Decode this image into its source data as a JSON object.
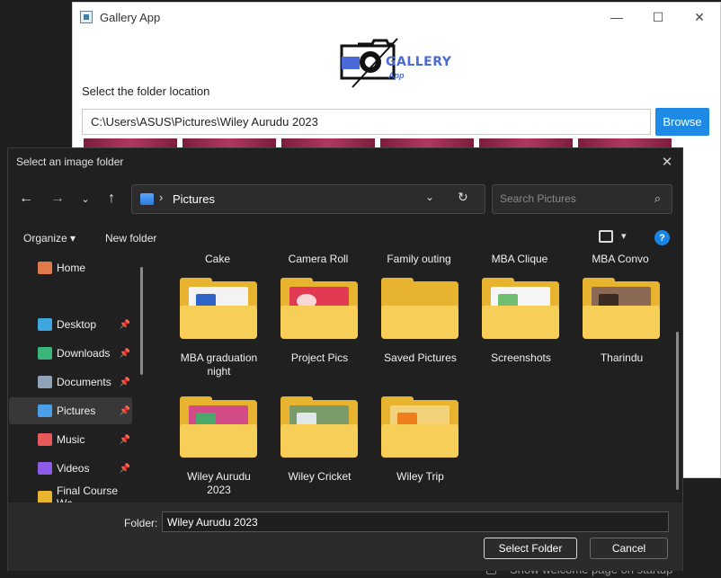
{
  "background": {
    "hint_text": "Show welcome page on startup"
  },
  "gallery_app": {
    "title": "Gallery App",
    "logo_text": "GALLERY",
    "logo_sub": "App",
    "folder_label": "Select the folder location",
    "folder_path": "C:\\Users\\ASUS\\Pictures\\Wiley Aurudu 2023",
    "browse_label": "Browse",
    "window_controls": {
      "minimize": "—",
      "maximize": "☐",
      "close": "✕"
    }
  },
  "dialog": {
    "title": "Select an image folder",
    "address": {
      "location": "Pictures"
    },
    "search_placeholder": "Search Pictures",
    "toolbar": {
      "organize": "Organize",
      "new_folder": "New folder"
    },
    "nav_items": [
      {
        "label": "Home",
        "icon": "home-icon",
        "color": "#e07a4a",
        "pinned": false
      },
      {
        "label": "Desktop",
        "icon": "desktop-icon",
        "color": "#3fa7e0",
        "pinned": true
      },
      {
        "label": "Downloads",
        "icon": "downloads-icon",
        "color": "#3bb57a",
        "pinned": true
      },
      {
        "label": "Documents",
        "icon": "documents-icon",
        "color": "#8fa2b8",
        "pinned": true
      },
      {
        "label": "Pictures",
        "icon": "pictures-icon",
        "color": "#4a9fe8",
        "pinned": true
      },
      {
        "label": "Music",
        "icon": "music-icon",
        "color": "#e85a5a",
        "pinned": true
      },
      {
        "label": "Videos",
        "icon": "videos-icon",
        "color": "#8e5ae8",
        "pinned": true
      },
      {
        "label": "Final Course Wc",
        "icon": "folder-icon",
        "color": "#e8b32e",
        "pinned": false
      }
    ],
    "top_row_captions": [
      "Cake",
      "Camera Roll",
      "Family outing",
      "MBA Clique",
      "MBA Convo"
    ],
    "folders": [
      {
        "name": "MBA graduation night",
        "line1": "MBA graduation",
        "line2": "night",
        "preview": "word-doc"
      },
      {
        "name": "Project Pics",
        "line1": "Project Pics",
        "line2": "",
        "preview": "red-photo"
      },
      {
        "name": "Saved Pictures",
        "line1": "Saved Pictures",
        "line2": "",
        "preview": "none"
      },
      {
        "name": "Screenshots",
        "line1": "Screenshots",
        "line2": "",
        "preview": "screenshot"
      },
      {
        "name": "Tharindu",
        "line1": "Tharindu",
        "line2": "",
        "preview": "portrait"
      },
      {
        "name": "Wiley Aurudu 2023",
        "line1": "Wiley Aurudu",
        "line2": "2023",
        "preview": "pink-photo"
      },
      {
        "name": "Wiley Cricket",
        "line1": "Wiley Cricket",
        "line2": "",
        "preview": "field-photo"
      },
      {
        "name": "Wiley Trip",
        "line1": "Wiley Trip",
        "line2": "",
        "preview": "vlc-cone"
      }
    ],
    "folder_label": "Folder:",
    "folder_value": "Wiley Aurudu 2023",
    "select_button": "Select Folder",
    "cancel_button": "Cancel"
  }
}
